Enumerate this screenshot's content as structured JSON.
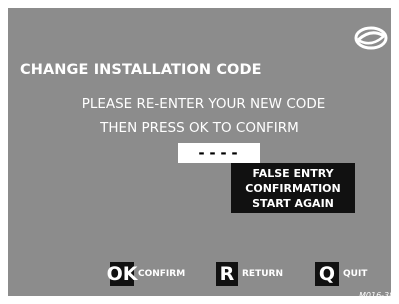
{
  "screen": {
    "title": "CHANGE INSTALLATION CODE",
    "instruction_line1": "PLEASE RE-ENTER YOUR NEW CODE",
    "instruction_line2": "THEN PRESS OK TO CONFIRM",
    "code_value": "----",
    "error_lines": [
      "FALSE ENTRY",
      "CONFIRMATION",
      "START AGAIN"
    ],
    "reference": "M016-38"
  },
  "keys": [
    {
      "key": "OK",
      "label": "CONFIRM"
    },
    {
      "key": "R",
      "label": "RETURN"
    },
    {
      "key": "Q",
      "label": "QUIT"
    }
  ],
  "colors": {
    "screen_background": "#8c8c8c",
    "text": "#ffffff",
    "key_background": "#111111",
    "error_background": "#111111"
  },
  "icons": {
    "logo": "eye-logo-icon"
  }
}
